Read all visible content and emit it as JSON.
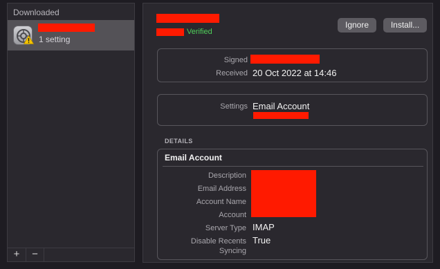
{
  "sidebar": {
    "header": "Downloaded",
    "profile": {
      "subtitle": "1 setting"
    },
    "footer": {
      "add": "+",
      "remove": "−"
    }
  },
  "main": {
    "verified": "Verified",
    "buttons": {
      "ignore": "Ignore",
      "install": "Install..."
    },
    "info": {
      "signed_label": "Signed",
      "received_label": "Received",
      "received_value": "20 Oct 2022 at 14:46"
    },
    "settings": {
      "label": "Settings",
      "value": "Email Account"
    },
    "details_heading": "DETAILS",
    "details_box": {
      "title": "Email Account",
      "rows": [
        {
          "label": "Description",
          "value": ""
        },
        {
          "label": "Email Address",
          "value": ""
        },
        {
          "label": "Account Name",
          "value": ""
        },
        {
          "label": "Account",
          "value": ""
        },
        {
          "label": "Server Type",
          "value": "IMAP"
        },
        {
          "label": "Disable Recents",
          "value": "True"
        },
        {
          "label": "Syncing",
          "value": ""
        }
      ]
    }
  },
  "colors": {
    "verified": "#4fd15a",
    "redaction": "#ff1a00"
  }
}
